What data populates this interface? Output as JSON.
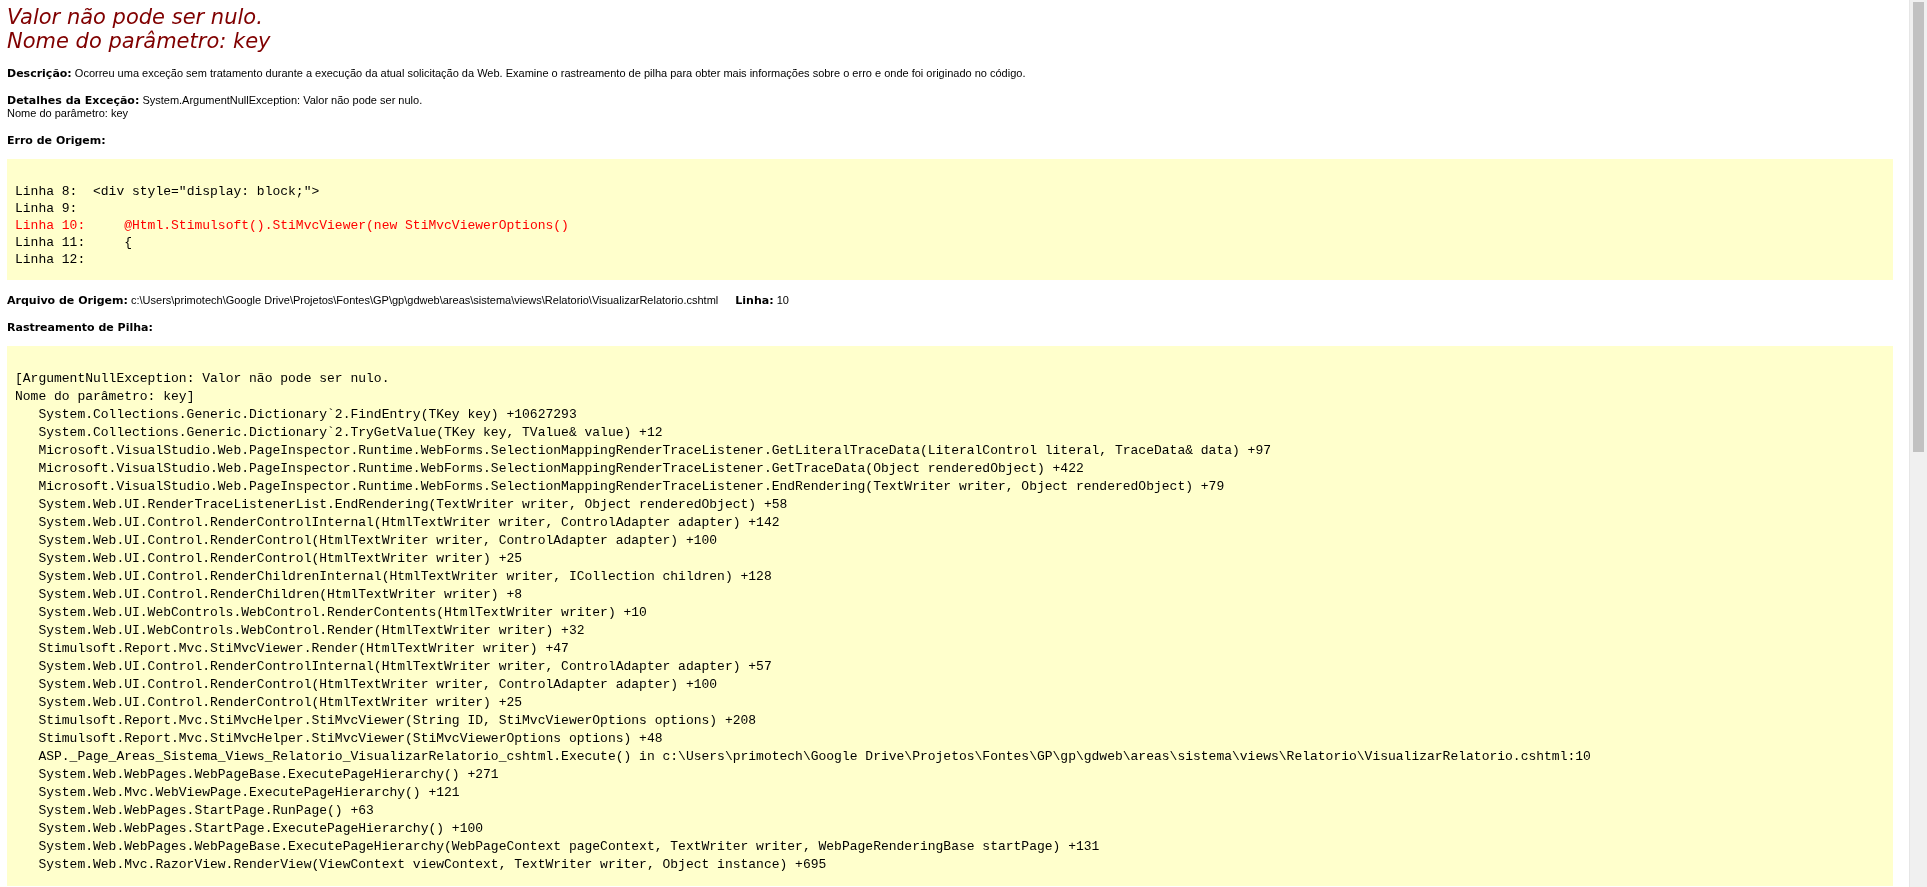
{
  "title": [
    "Valor não pode ser nulo.",
    "Nome do parâmetro: key"
  ],
  "description": {
    "label": "Descrição:",
    "text": "Ocorreu uma exceção sem tratamento durante a execução da atual solicitação da Web. Examine o rastreamento de pilha para obter mais informações sobre o erro e onde foi originado no código."
  },
  "exception_details": {
    "label": "Detalhes da Exceção:",
    "text": "System.ArgumentNullException: Valor não pode ser nulo.",
    "text_2": "Nome do parâmetro: key"
  },
  "source_error": {
    "heading": "Erro de Origem:",
    "lines": [
      {
        "text": "Linha 8:  <div style=\"display: block;\">",
        "highlighted": false
      },
      {
        "text": "Linha 9:",
        "highlighted": false
      },
      {
        "text": "Linha 10:     @Html.Stimulsoft().StiMvcViewer(new StiMvcViewerOptions()",
        "highlighted": true
      },
      {
        "text": "Linha 11:     {",
        "highlighted": false
      },
      {
        "text": "Linha 12:",
        "highlighted": false
      }
    ]
  },
  "source_file": {
    "label": "Arquivo de Origem:",
    "path": "c:\\Users\\primotech\\Google Drive\\Projetos\\Fontes\\GP\\gp\\gdweb\\areas\\sistema\\views\\Relatorio\\VisualizarRelatorio.cshtml",
    "line_label": "Linha:",
    "line": "10"
  },
  "stack_trace": {
    "heading": "Rastreamento de Pilha:",
    "message": [
      "[ArgumentNullException: Valor não pode ser nulo.",
      "Nome do parâmetro: key]"
    ],
    "frames": [
      "System.Collections.Generic.Dictionary`2.FindEntry(TKey key) +10627293",
      "System.Collections.Generic.Dictionary`2.TryGetValue(TKey key, TValue& value) +12",
      "Microsoft.VisualStudio.Web.PageInspector.Runtime.WebForms.SelectionMappingRenderTraceListener.GetLiteralTraceData(LiteralControl literal, TraceData& data) +97",
      "Microsoft.VisualStudio.Web.PageInspector.Runtime.WebForms.SelectionMappingRenderTraceListener.GetTraceData(Object renderedObject) +422",
      "Microsoft.VisualStudio.Web.PageInspector.Runtime.WebForms.SelectionMappingRenderTraceListener.EndRendering(TextWriter writer, Object renderedObject) +79",
      "System.Web.UI.RenderTraceListenerList.EndRendering(TextWriter writer, Object renderedObject) +58",
      "System.Web.UI.Control.RenderControlInternal(HtmlTextWriter writer, ControlAdapter adapter) +142",
      "System.Web.UI.Control.RenderControl(HtmlTextWriter writer, ControlAdapter adapter) +100",
      "System.Web.UI.Control.RenderControl(HtmlTextWriter writer) +25",
      "System.Web.UI.Control.RenderChildrenInternal(HtmlTextWriter writer, ICollection children) +128",
      "System.Web.UI.Control.RenderChildren(HtmlTextWriter writer) +8",
      "System.Web.UI.WebControls.WebControl.RenderContents(HtmlTextWriter writer) +10",
      "System.Web.UI.WebControls.WebControl.Render(HtmlTextWriter writer) +32",
      "Stimulsoft.Report.Mvc.StiMvcViewer.Render(HtmlTextWriter writer) +47",
      "System.Web.UI.Control.RenderControlInternal(HtmlTextWriter writer, ControlAdapter adapter) +57",
      "System.Web.UI.Control.RenderControl(HtmlTextWriter writer, ControlAdapter adapter) +100",
      "System.Web.UI.Control.RenderControl(HtmlTextWriter writer) +25",
      "Stimulsoft.Report.Mvc.StiMvcHelper.StiMvcViewer(String ID, StiMvcViewerOptions options) +208",
      "Stimulsoft.Report.Mvc.StiMvcHelper.StiMvcViewer(StiMvcViewerOptions options) +48",
      "ASP._Page_Areas_Sistema_Views_Relatorio_VisualizarRelatorio_cshtml.Execute() in c:\\Users\\primotech\\Google Drive\\Projetos\\Fontes\\GP\\gp\\gdweb\\areas\\sistema\\views\\Relatorio\\VisualizarRelatorio.cshtml:10",
      "System.Web.WebPages.WebPageBase.ExecutePageHierarchy() +271",
      "System.Web.Mvc.WebViewPage.ExecutePageHierarchy() +121",
      "System.Web.WebPages.StartPage.RunPage() +63",
      "System.Web.WebPages.StartPage.ExecutePageHierarchy() +100",
      "System.Web.WebPages.WebPageBase.ExecutePageHierarchy(WebPageContext pageContext, TextWriter writer, WebPageRenderingBase startPage) +131",
      "System.Web.Mvc.RazorView.RenderView(ViewContext viewContext, TextWriter writer, Object instance) +695"
    ]
  }
}
